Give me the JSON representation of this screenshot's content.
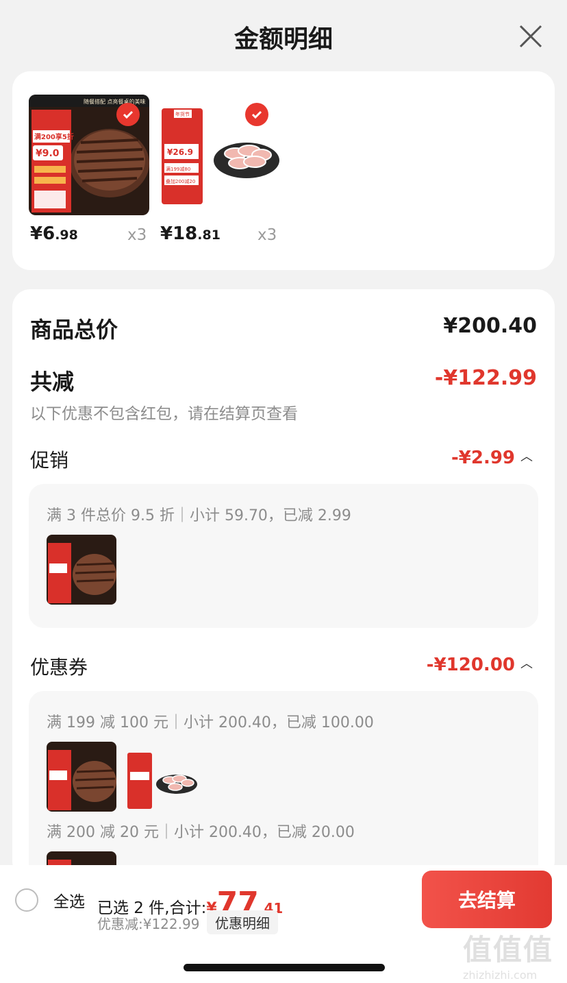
{
  "header": {
    "title": "金额明细",
    "close_icon": "close-icon"
  },
  "products": [
    {
      "name": "steak",
      "price_int": "¥6",
      "price_dec": ".98",
      "qty": "x3",
      "checked": true
    },
    {
      "name": "lamb-roll",
      "price_int": "¥18",
      "price_dec": ".81",
      "qty": "x3",
      "checked": true
    }
  ],
  "product_art": {
    "steak": {
      "badge": "满200享5折",
      "price_tag": "¥9.0",
      "banner": "随餐搭配 点亮餐桌的美味"
    },
    "lamb": {
      "banner": "年货节",
      "price_tag": "¥26.9",
      "tag1": "满199减80",
      "tag2": "叠加200减20"
    }
  },
  "summary": {
    "total_label": "商品总价",
    "total_value": "¥200.40",
    "reduce_label": "共减",
    "reduce_value": "-¥122.99",
    "note": "以下优惠不包含红包，请在结算页查看"
  },
  "promotion": {
    "label": "促销",
    "value": "-¥2.99",
    "rules": [
      {
        "text": "满 3 件总价 9.5 折｜小计 59.70，已减 2.99"
      }
    ]
  },
  "coupon": {
    "label": "优惠券",
    "value": "-¥120.00",
    "rules": [
      {
        "text": "满 199 减 100 元｜小计 200.40，已减 100.00"
      },
      {
        "text": "满 200 减 20 元｜小计 200.40，已减 20.00"
      }
    ]
  },
  "bottom_bar": {
    "select_all": "全选",
    "selected_text": "已选 2 件,合计:",
    "total_yen": "¥",
    "total_int": "77",
    "total_dec": ".41",
    "discount_text": "优惠减:¥122.99",
    "detail_button": "优惠明细",
    "checkout_button": "去结算"
  },
  "watermark": {
    "glyphs": "值值值",
    "site": "zhizhizhi.com"
  },
  "colors": {
    "accent": "#e0372d",
    "background": "#f2f2f2",
    "card": "#ffffff"
  }
}
